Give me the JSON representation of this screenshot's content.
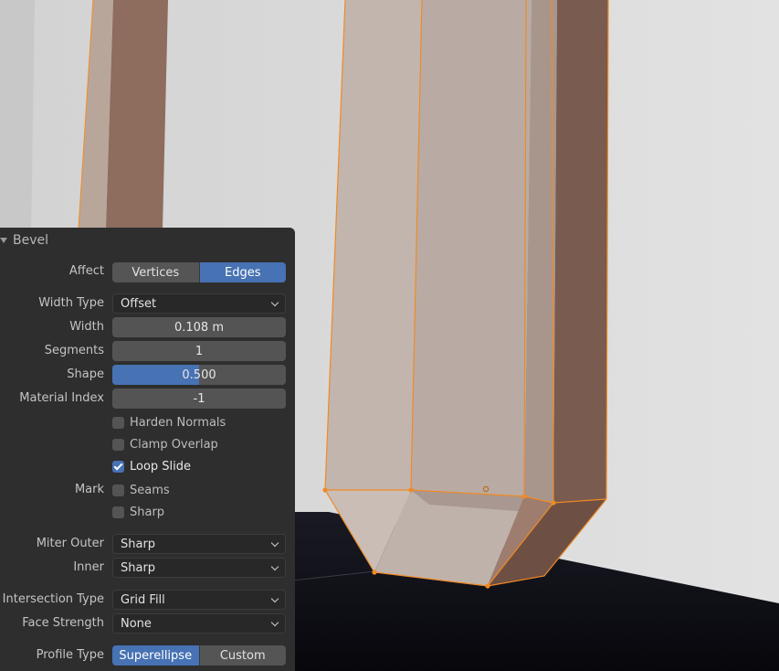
{
  "panel": {
    "title": "Bevel",
    "affect": {
      "label": "Affect",
      "options": [
        "Vertices",
        "Edges"
      ],
      "selected": "Edges"
    },
    "width_type": {
      "label": "Width Type",
      "value": "Offset"
    },
    "width": {
      "label": "Width",
      "value": "0.108 m"
    },
    "segments": {
      "label": "Segments",
      "value": "1"
    },
    "shape": {
      "label": "Shape",
      "value": "0.500",
      "fraction": 0.5
    },
    "material_index": {
      "label": "Material Index",
      "value": "-1"
    },
    "harden_normals": {
      "label": "Harden Normals",
      "checked": false
    },
    "clamp_overlap": {
      "label": "Clamp Overlap",
      "checked": false
    },
    "loop_slide": {
      "label": "Loop Slide",
      "checked": true
    },
    "mark": {
      "label": "Mark",
      "seams": {
        "label": "Seams",
        "checked": false
      },
      "sharp": {
        "label": "Sharp",
        "checked": false
      }
    },
    "miter_outer": {
      "label": "Miter Outer",
      "value": "Sharp"
    },
    "miter_inner": {
      "label": "Inner",
      "value": "Sharp"
    },
    "intersection_type": {
      "label": "Intersection Type",
      "value": "Grid Fill"
    },
    "face_strength": {
      "label": "Face Strength",
      "value": "None"
    },
    "profile_type": {
      "label": "Profile Type",
      "options": [
        "Superellipse",
        "Custom"
      ],
      "selected": "Superellipse"
    }
  },
  "colors": {
    "accent": "#4772b3",
    "panel_bg": "#2e2e2e",
    "selection_orange": "#f08a24",
    "mesh_face": "#b9aaa2",
    "floor": "#0d0d15"
  }
}
